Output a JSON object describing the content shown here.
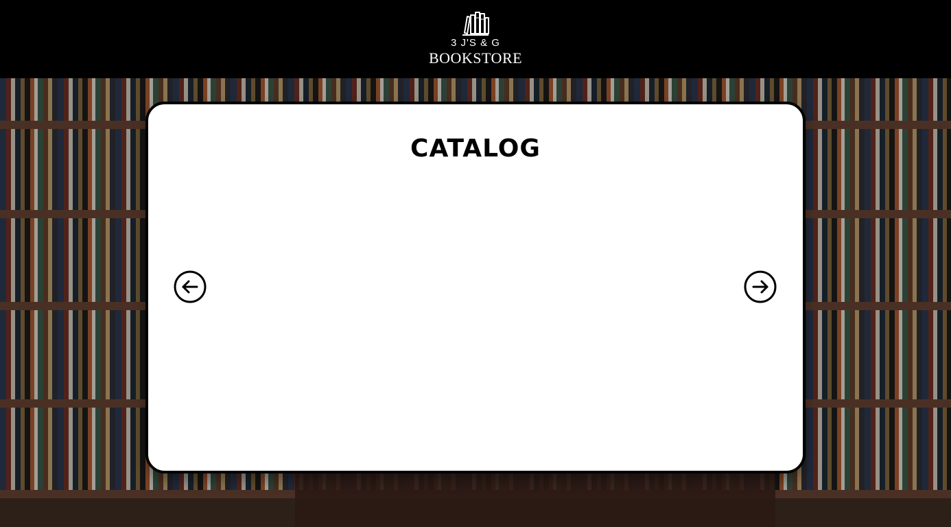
{
  "header": {
    "logo_icon": "books-icon",
    "brand_line1": "3 J'S & G",
    "brand_line2": "BOOKSTORE"
  },
  "catalog": {
    "title": "CATALOG",
    "prev_icon": "arrow-left-circle-icon",
    "next_icon": "arrow-right-circle-icon"
  },
  "colors": {
    "header_bg": "#000000",
    "card_bg": "#ffffff",
    "card_border": "#000000",
    "text_light": "#ffffff",
    "text_dark": "#000000"
  }
}
